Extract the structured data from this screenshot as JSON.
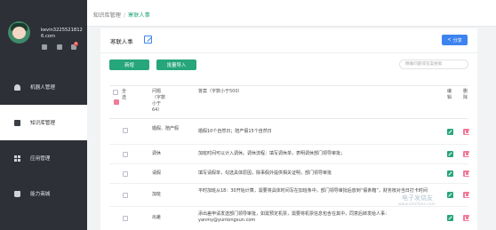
{
  "sidebar": {
    "user": {
      "name": "kevin32255218126.com"
    },
    "notification_count": "8",
    "items": [
      {
        "label": "机器人管理",
        "icon": "robot-icon"
      },
      {
        "label": "知识库管理",
        "icon": "book-icon"
      },
      {
        "label": "应用管理",
        "icon": "grid-icon"
      },
      {
        "label": "能力商城",
        "icon": "shop-icon"
      }
    ]
  },
  "header": {
    "breadcrumb": {
      "root": "知识库管理",
      "separator": "/",
      "current": "寒联人事"
    }
  },
  "panel": {
    "title": "寒联人事",
    "share_label": "分享",
    "add_label": "新增",
    "import_label": "批量导入",
    "search_placeholder": "精确问题或答案搜索"
  },
  "table": {
    "select_all": "全选",
    "col_question": "问题（字数小于64）",
    "col_answer": "答案（字数小于500）",
    "col_edit": "编辑",
    "col_delete": "删除",
    "rows": [
      {
        "question": "婚假、陪产假",
        "answer": "婚假10个自然日；陪产假15个自然日"
      },
      {
        "question": "调休",
        "answer": "加班时间可以计入调休。调休流程：填写调休单，表明调休部门领导审批；"
      },
      {
        "question": "请假",
        "answer": "填写请假单，勾选具体原因，除事假外提供相关证明，部门领导审批"
      },
      {
        "question": "加班",
        "answer": "平时加班从18：30开始计算，需要将具体时间写在加班条中，部门领导审批后放到“假条箱”，财务核对当日打卡时间"
      },
      {
        "question": "出差",
        "answer": "添出差申请发送部门领导审批，如需预定机票，需要将机票信息包含在其中，同意后转发给人事：yanmy@yuntongxun.com"
      }
    ]
  },
  "watermark": {
    "text": "电子发烧友",
    "sub": "www.elecfans.com"
  },
  "colors": {
    "accent_green": "#26a67a",
    "accent_blue": "#3d84f0",
    "sidebar_bg": "#2d3036",
    "delete_pink": "#f07a98"
  }
}
